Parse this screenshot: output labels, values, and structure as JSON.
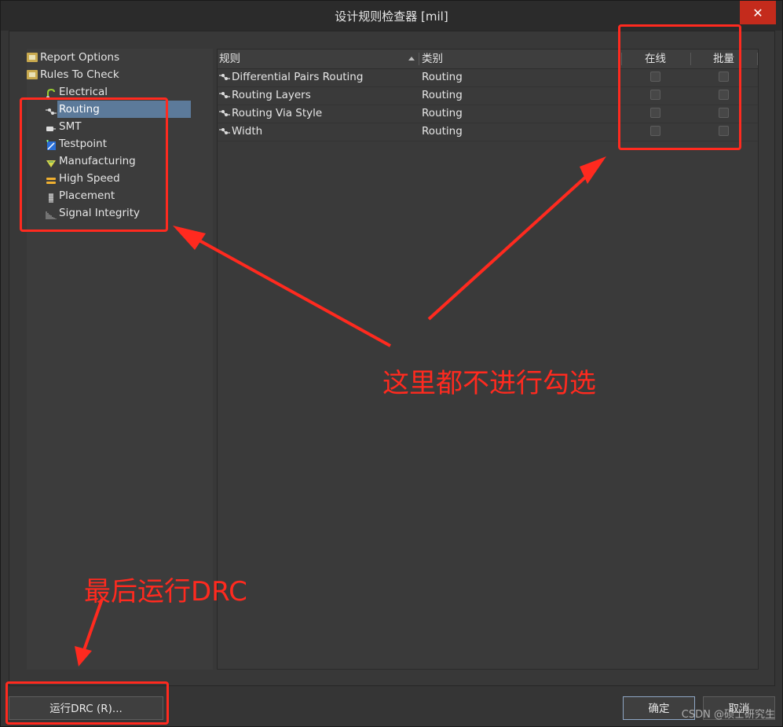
{
  "window": {
    "title": "设计规则检查器 [mil]",
    "close_label": "✕"
  },
  "tree": {
    "items": [
      {
        "label": "Report Options",
        "icon": "folder-icon"
      },
      {
        "label": "Rules To Check",
        "icon": "folder-icon"
      },
      {
        "label": "Electrical",
        "icon": "electrical-icon"
      },
      {
        "label": "Routing",
        "icon": "routing-icon",
        "selected": true
      },
      {
        "label": "SMT",
        "icon": "smt-icon"
      },
      {
        "label": "Testpoint",
        "icon": "testpoint-icon"
      },
      {
        "label": "Manufacturing",
        "icon": "manufacturing-icon"
      },
      {
        "label": "High Speed",
        "icon": "high-speed-icon"
      },
      {
        "label": "Placement",
        "icon": "placement-icon"
      },
      {
        "label": "Signal Integrity",
        "icon": "signal-integrity-icon"
      }
    ]
  },
  "table": {
    "columns": {
      "rule": "规则",
      "category": "类别",
      "online": "在线",
      "batch": "批量"
    },
    "rows": [
      {
        "rule": "Differential Pairs Routing",
        "category": "Routing",
        "online": false,
        "batch": false
      },
      {
        "rule": "Routing Layers",
        "category": "Routing",
        "online": false,
        "batch": false
      },
      {
        "rule": "Routing Via Style",
        "category": "Routing",
        "online": false,
        "batch": false
      },
      {
        "rule": "Width",
        "category": "Routing",
        "online": false,
        "batch": false
      }
    ]
  },
  "buttons": {
    "run_drc": "运行DRC (R)...",
    "ok": "确定",
    "cancel": "取消"
  },
  "annotations": {
    "no_check_note": "这里都不进行勾选",
    "run_drc_note": "最后运行DRC"
  },
  "watermark": "CSDN @硕士研究生"
}
